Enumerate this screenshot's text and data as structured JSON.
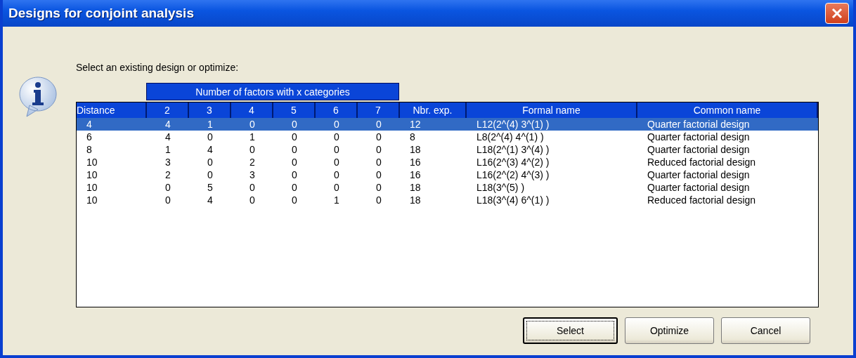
{
  "window": {
    "title": "Designs for conjoint analysis"
  },
  "prompt": "Select an existing design or optimize:",
  "table": {
    "group_header": "Number of factors with x categories",
    "columns": [
      "Distance",
      "2",
      "3",
      "4",
      "5",
      "6",
      "7",
      "Nbr. exp.",
      "Formal name",
      "Common name"
    ],
    "rows": [
      {
        "selected": true,
        "cells": [
          "4",
          "4",
          "1",
          "0",
          "0",
          "0",
          "0",
          "12",
          "L12(2^(4) 3^(1) )",
          "Quarter factorial design"
        ]
      },
      {
        "selected": false,
        "cells": [
          "6",
          "4",
          "0",
          "1",
          "0",
          "0",
          "0",
          "8",
          "L8(2^(4) 4^(1) )",
          "Quarter factorial design"
        ]
      },
      {
        "selected": false,
        "cells": [
          "8",
          "1",
          "4",
          "0",
          "0",
          "0",
          "0",
          "18",
          "L18(2^(1) 3^(4) )",
          "Quarter factorial design"
        ]
      },
      {
        "selected": false,
        "cells": [
          "10",
          "3",
          "0",
          "2",
          "0",
          "0",
          "0",
          "16",
          "L16(2^(3) 4^(2) )",
          "Reduced factorial design"
        ]
      },
      {
        "selected": false,
        "cells": [
          "10",
          "2",
          "0",
          "3",
          "0",
          "0",
          "0",
          "16",
          "L16(2^(2) 4^(3) )",
          "Quarter factorial design"
        ]
      },
      {
        "selected": false,
        "cells": [
          "10",
          "0",
          "5",
          "0",
          "0",
          "0",
          "0",
          "18",
          "L18(3^(5) )",
          "Quarter factorial design"
        ]
      },
      {
        "selected": false,
        "cells": [
          "10",
          "0",
          "4",
          "0",
          "0",
          "1",
          "0",
          "18",
          "L18(3^(4) 6^(1) )",
          "Reduced factorial design"
        ]
      }
    ]
  },
  "buttons": [
    {
      "label": "Select",
      "default": true
    },
    {
      "label": "Optimize",
      "default": false
    },
    {
      "label": "Cancel",
      "default": false
    }
  ]
}
